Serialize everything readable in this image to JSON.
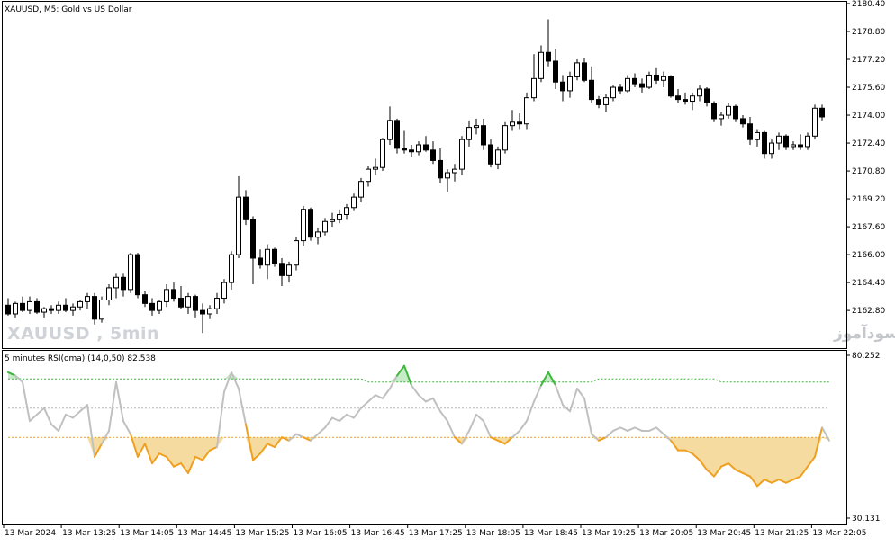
{
  "chart_data": [
    {
      "type": "candlestick",
      "symbol_label": "XAUUSD, M5:  Gold vs US Dollar",
      "watermark": "XAUUSD , 5min",
      "watermark_fa": "انتشار در سایت سودآموز",
      "ylim": [
        2161.0,
        2180.4
      ],
      "y_ticks": [
        2180.4,
        2178.8,
        2177.2,
        2175.6,
        2174.0,
        2172.4,
        2170.8,
        2169.2,
        2167.6,
        2166.0,
        2164.4,
        2162.8
      ],
      "x_ticks": [
        "13 Mar 2024",
        "13 Mar 13:25",
        "13 Mar 14:05",
        "13 Mar 14:45",
        "13 Mar 15:25",
        "13 Mar 16:05",
        "13 Mar 16:45",
        "13 Mar 17:25",
        "13 Mar 18:05",
        "13 Mar 18:45",
        "13 Mar 19:25",
        "13 Mar 20:05",
        "13 Mar 20:45",
        "13 Mar 21:25",
        "13 Mar 22:05"
      ],
      "colors": {
        "bull_body": "#ffffff",
        "bear_body": "#000000",
        "wick": "#000000"
      },
      "candles": [
        [
          2163.1,
          2163.5,
          2162.5,
          2162.6
        ],
        [
          2162.6,
          2163.3,
          2162.4,
          2163.2
        ],
        [
          2163.2,
          2163.6,
          2162.7,
          2162.8
        ],
        [
          2162.8,
          2163.6,
          2162.6,
          2163.3
        ],
        [
          2163.3,
          2163.5,
          2162.6,
          2162.7
        ],
        [
          2162.7,
          2163.0,
          2162.4,
          2162.9
        ],
        [
          2162.9,
          2163.1,
          2162.6,
          2162.8
        ],
        [
          2162.8,
          2163.3,
          2162.6,
          2163.1
        ],
        [
          2163.1,
          2163.5,
          2162.7,
          2162.8
        ],
        [
          2162.8,
          2163.2,
          2162.5,
          2163.0
        ],
        [
          2163.0,
          2163.4,
          2162.8,
          2163.3
        ],
        [
          2163.3,
          2163.8,
          2162.9,
          2163.6
        ],
        [
          2163.6,
          2163.8,
          2162.0,
          2162.3
        ],
        [
          2162.3,
          2163.6,
          2162.1,
          2163.4
        ],
        [
          2163.4,
          2164.3,
          2163.1,
          2164.1
        ],
        [
          2164.1,
          2164.9,
          2163.5,
          2164.7
        ],
        [
          2164.7,
          2164.9,
          2163.6,
          2164.0
        ],
        [
          2164.0,
          2166.1,
          2163.8,
          2166.0
        ],
        [
          2166.0,
          2166.1,
          2163.5,
          2163.7
        ],
        [
          2163.7,
          2163.9,
          2163.0,
          2163.2
        ],
        [
          2163.2,
          2163.5,
          2162.5,
          2162.8
        ],
        [
          2162.8,
          2163.4,
          2162.6,
          2163.3
        ],
        [
          2163.3,
          2164.3,
          2163.0,
          2164.0
        ],
        [
          2164.0,
          2164.4,
          2163.3,
          2163.5
        ],
        [
          2163.5,
          2164.2,
          2162.9,
          2163.0
        ],
        [
          2163.0,
          2163.8,
          2162.6,
          2163.6
        ],
        [
          2163.6,
          2163.7,
          2162.4,
          2162.8
        ],
        [
          2162.8,
          2163.2,
          2161.5,
          2162.6
        ],
        [
          2162.6,
          2163.1,
          2162.3,
          2162.9
        ],
        [
          2162.9,
          2163.8,
          2162.6,
          2163.5
        ],
        [
          2163.5,
          2164.6,
          2163.2,
          2164.4
        ],
        [
          2164.4,
          2166.2,
          2164.0,
          2166.0
        ],
        [
          2166.0,
          2170.5,
          2165.8,
          2169.3
        ],
        [
          2169.3,
          2169.7,
          2167.7,
          2168.0
        ],
        [
          2168.0,
          2168.2,
          2164.3,
          2165.8
        ],
        [
          2165.8,
          2166.3,
          2165.2,
          2165.4
        ],
        [
          2165.4,
          2166.6,
          2164.6,
          2166.3
        ],
        [
          2166.3,
          2166.4,
          2165.3,
          2165.5
        ],
        [
          2165.5,
          2165.8,
          2164.2,
          2164.8
        ],
        [
          2164.8,
          2165.6,
          2164.4,
          2165.4
        ],
        [
          2165.4,
          2167.0,
          2165.1,
          2166.8
        ],
        [
          2166.8,
          2168.8,
          2166.5,
          2168.6
        ],
        [
          2168.6,
          2168.7,
          2166.8,
          2167.0
        ],
        [
          2167.0,
          2167.5,
          2166.6,
          2167.3
        ],
        [
          2167.3,
          2168.1,
          2167.1,
          2167.9
        ],
        [
          2167.9,
          2168.4,
          2167.6,
          2168.0
        ],
        [
          2168.0,
          2168.6,
          2167.8,
          2168.3
        ],
        [
          2168.3,
          2168.9,
          2168.0,
          2168.7
        ],
        [
          2168.7,
          2169.5,
          2168.5,
          2169.3
        ],
        [
          2169.3,
          2170.4,
          2169.0,
          2170.2
        ],
        [
          2170.2,
          2171.1,
          2169.9,
          2170.9
        ],
        [
          2170.9,
          2171.5,
          2170.6,
          2171.0
        ],
        [
          2171.0,
          2172.7,
          2170.8,
          2172.6
        ],
        [
          2172.6,
          2174.5,
          2172.3,
          2173.7
        ],
        [
          2173.7,
          2173.8,
          2171.8,
          2172.1
        ],
        [
          2172.1,
          2173.1,
          2171.8,
          2172.0
        ],
        [
          2172.0,
          2172.3,
          2171.6,
          2171.9
        ],
        [
          2171.9,
          2172.5,
          2171.7,
          2172.3
        ],
        [
          2172.3,
          2172.8,
          2171.9,
          2172.0
        ],
        [
          2172.0,
          2172.5,
          2171.2,
          2171.4
        ],
        [
          2171.4,
          2172.1,
          2170.1,
          2170.4
        ],
        [
          2170.4,
          2170.9,
          2169.6,
          2170.7
        ],
        [
          2170.7,
          2171.2,
          2170.2,
          2170.9
        ],
        [
          2170.9,
          2172.8,
          2170.6,
          2172.6
        ],
        [
          2172.6,
          2173.7,
          2172.2,
          2173.3
        ],
        [
          2173.3,
          2173.8,
          2172.9,
          2173.4
        ],
        [
          2173.4,
          2173.8,
          2172.0,
          2172.3
        ],
        [
          2172.3,
          2172.6,
          2171.0,
          2171.2
        ],
        [
          2171.2,
          2172.2,
          2170.9,
          2172.0
        ],
        [
          2172.0,
          2173.6,
          2171.8,
          2173.4
        ],
        [
          2173.4,
          2174.3,
          2173.1,
          2173.6
        ],
        [
          2173.6,
          2174.1,
          2173.2,
          2173.5
        ],
        [
          2173.5,
          2175.3,
          2173.2,
          2175.0
        ],
        [
          2175.0,
          2177.5,
          2174.8,
          2176.1
        ],
        [
          2176.1,
          2178.0,
          2175.9,
          2177.6
        ],
        [
          2177.6,
          2179.5,
          2176.8,
          2177.1
        ],
        [
          2177.1,
          2177.8,
          2175.5,
          2175.9
        ],
        [
          2175.9,
          2176.3,
          2174.8,
          2175.4
        ],
        [
          2175.4,
          2176.5,
          2175.0,
          2176.2
        ],
        [
          2176.2,
          2177.2,
          2176.0,
          2177.0
        ],
        [
          2177.0,
          2177.3,
          2175.9,
          2176.0
        ],
        [
          2176.0,
          2176.8,
          2174.7,
          2174.9
        ],
        [
          2174.9,
          2175.1,
          2174.4,
          2174.6
        ],
        [
          2174.6,
          2175.2,
          2174.2,
          2175.0
        ],
        [
          2175.0,
          2175.7,
          2174.8,
          2175.6
        ],
        [
          2175.6,
          2175.8,
          2175.2,
          2175.4
        ],
        [
          2175.4,
          2176.3,
          2175.3,
          2176.1
        ],
        [
          2176.1,
          2176.4,
          2175.6,
          2175.8
        ],
        [
          2175.8,
          2176.1,
          2175.3,
          2175.6
        ],
        [
          2175.6,
          2176.5,
          2175.5,
          2176.3
        ],
        [
          2176.3,
          2176.7,
          2175.8,
          2176.0
        ],
        [
          2176.0,
          2176.5,
          2175.6,
          2176.2
        ],
        [
          2176.2,
          2176.3,
          2175.0,
          2175.1
        ],
        [
          2175.1,
          2175.5,
          2174.7,
          2174.9
        ],
        [
          2174.9,
          2175.3,
          2174.6,
          2174.8
        ],
        [
          2174.8,
          2175.3,
          2174.3,
          2175.1
        ],
        [
          2175.1,
          2175.7,
          2174.8,
          2175.5
        ],
        [
          2175.5,
          2175.6,
          2174.5,
          2174.7
        ],
        [
          2174.7,
          2174.8,
          2173.6,
          2173.8
        ],
        [
          2173.8,
          2174.2,
          2173.4,
          2174.0
        ],
        [
          2174.0,
          2174.7,
          2173.8,
          2174.5
        ],
        [
          2174.5,
          2174.6,
          2173.6,
          2173.8
        ],
        [
          2173.8,
          2174.0,
          2173.3,
          2173.5
        ],
        [
          2173.5,
          2173.9,
          2172.3,
          2172.6
        ],
        [
          2172.6,
          2173.2,
          2172.2,
          2173.0
        ],
        [
          2173.0,
          2173.1,
          2171.5,
          2171.8
        ],
        [
          2171.8,
          2172.6,
          2171.5,
          2172.4
        ],
        [
          2172.4,
          2173.0,
          2172.0,
          2172.8
        ],
        [
          2172.8,
          2172.9,
          2172.0,
          2172.2
        ],
        [
          2172.2,
          2172.5,
          2172.0,
          2172.3
        ],
        [
          2172.3,
          2172.9,
          2172.0,
          2172.2
        ],
        [
          2172.2,
          2173.0,
          2172.0,
          2172.8
        ],
        [
          2172.8,
          2174.6,
          2172.6,
          2174.4
        ],
        [
          2174.4,
          2174.6,
          2173.7,
          2173.9
        ]
      ]
    },
    {
      "type": "line",
      "indicator_label": "5 minutes RSI(oma) (14,0,50) 82.538",
      "ylim": [
        30.131,
        80.252
      ],
      "y_ticks": [
        80.252,
        30.131
      ],
      "colors": {
        "rsi": "#c0c0c0",
        "up": "#3cb83c",
        "down": "#f0a020",
        "upper_level": "#3cb83c",
        "middle_level": "#b8b8b8",
        "lower_level": "#f0a020",
        "up_fill": "#c8ecc8",
        "down_fill": "#f5dba0"
      },
      "rsi": [
        75,
        74,
        72,
        60,
        62,
        64,
        59,
        57,
        62,
        61,
        63,
        65,
        49,
        53,
        57,
        72,
        60,
        56,
        49,
        53,
        47,
        50,
        49,
        46,
        47,
        44,
        49,
        48,
        51,
        52,
        69,
        75,
        70,
        59,
        48,
        50,
        53,
        52,
        55,
        54,
        56,
        55,
        54,
        56,
        58,
        61,
        60,
        62,
        61,
        64,
        66,
        68,
        67,
        70,
        74,
        77,
        71,
        68,
        66,
        67,
        63,
        60,
        55,
        53,
        57,
        62,
        60,
        55,
        54,
        53,
        55,
        57,
        60,
        66,
        71,
        75,
        71,
        65,
        63,
        70,
        67,
        56,
        54,
        55,
        57,
        58,
        57,
        58,
        57,
        57,
        58,
        56,
        54,
        51,
        51,
        50,
        48,
        45,
        43,
        46,
        47,
        45,
        44,
        43,
        40,
        42,
        41,
        42,
        41,
        42,
        43,
        46,
        49,
        58,
        54
      ],
      "upper_level": [
        73,
        73,
        73,
        73,
        73,
        73,
        73,
        73,
        73,
        73,
        73,
        73,
        73,
        73,
        73,
        73,
        73,
        73,
        73,
        73,
        73,
        73,
        73,
        73,
        73,
        73,
        73,
        73,
        73,
        73,
        73,
        73,
        73,
        73,
        73,
        73,
        73,
        73,
        73,
        73,
        73,
        73,
        73,
        73,
        73,
        73,
        73,
        73,
        73,
        73,
        72,
        72,
        72,
        72,
        72,
        72,
        72,
        72,
        72,
        72,
        72,
        72,
        72,
        72,
        72,
        72,
        72,
        72,
        72,
        72,
        72,
        72,
        72,
        72,
        72,
        72,
        72,
        72,
        72,
        72,
        72,
        72,
        73,
        73,
        73,
        73,
        73,
        73,
        73,
        73,
        73,
        73,
        73,
        73,
        73,
        73,
        73,
        73,
        73,
        72,
        72,
        72,
        72,
        72,
        72,
        72,
        72,
        72,
        72,
        72,
        72,
        72,
        72,
        72,
        72
      ],
      "middle_level": [
        64,
        64,
        64,
        64,
        64,
        64,
        64,
        64,
        64,
        64,
        64,
        64,
        64,
        64,
        64,
        64,
        64,
        64,
        64,
        64,
        64,
        64,
        64,
        64,
        64,
        64,
        64,
        64,
        64,
        64,
        64,
        64,
        64,
        64,
        64,
        64,
        64,
        64,
        64,
        64,
        64,
        64,
        64,
        64,
        64,
        64,
        64,
        64,
        64,
        64,
        64,
        64,
        64,
        64,
        64,
        64,
        64,
        64,
        64,
        64,
        64,
        64,
        64,
        64,
        64,
        64,
        64,
        64,
        64,
        64,
        64,
        64,
        64,
        64,
        64,
        64,
        64,
        64,
        64,
        64,
        64,
        64,
        64,
        64,
        64,
        64,
        64,
        64,
        64,
        64,
        64,
        64,
        64,
        64,
        64,
        64,
        64,
        64,
        64,
        64,
        64,
        64,
        64,
        64,
        64,
        64,
        64,
        64,
        64,
        64,
        64,
        64,
        64,
        64,
        64
      ],
      "lower_level": [
        55,
        55,
        55,
        55,
        55,
        55,
        55,
        55,
        55,
        55,
        55,
        55,
        55,
        55,
        55,
        55,
        55,
        55,
        55,
        55,
        55,
        55,
        55,
        55,
        55,
        55,
        55,
        55,
        55,
        55,
        55,
        55,
        55,
        55,
        55,
        55,
        55,
        55,
        55,
        55,
        55,
        55,
        55,
        55,
        55,
        55,
        55,
        55,
        55,
        55,
        55,
        55,
        55,
        55,
        55,
        55,
        55,
        55,
        55,
        55,
        55,
        55,
        55,
        55,
        55,
        55,
        55,
        55,
        55,
        55,
        55,
        55,
        55,
        55,
        55,
        55,
        55,
        55,
        55,
        55,
        55,
        55,
        55,
        55,
        55,
        55,
        55,
        55,
        55,
        55,
        55,
        55,
        55,
        55,
        55,
        55,
        55,
        55,
        55,
        55,
        55,
        55,
        55,
        55,
        55,
        55,
        55,
        55,
        55,
        55,
        55,
        55,
        55,
        55,
        55
      ]
    }
  ]
}
